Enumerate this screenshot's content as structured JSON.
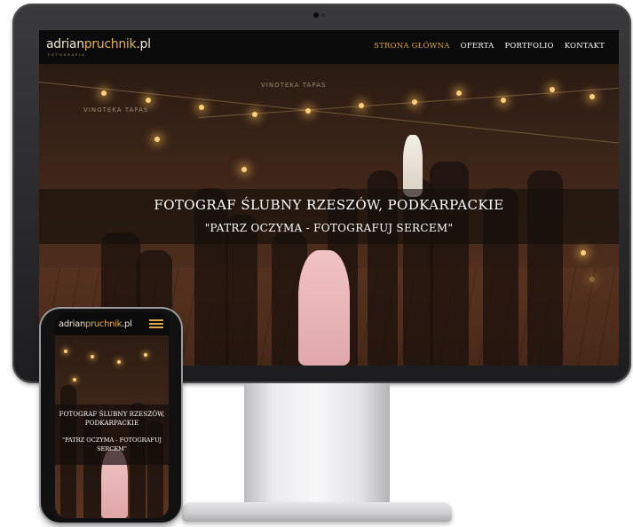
{
  "brand": {
    "logo_main": "adrian",
    "logo_accent": "pruchnik",
    "logo_suffix": ".pl",
    "logo_tagline": "FOTOGRAFIA",
    "accent_color": "#d9a64a"
  },
  "nav": {
    "items": [
      {
        "label": "STRONA GŁÓWNA",
        "active": true
      },
      {
        "label": "OFERTA",
        "active": false
      },
      {
        "label": "PORTFOLIO",
        "active": false
      },
      {
        "label": "KONTAKT",
        "active": false
      }
    ]
  },
  "hero": {
    "title": "FOTOGRAF ŚLUBNY RZESZÓW, PODKARPACKIE",
    "subtitle": "\"PATRZ OCZYMA - FOTOGRAFUJ SERCEM\""
  },
  "scene": {
    "sign_text": "VINOTEKA TAPAS"
  },
  "mobile": {
    "title_line1": "FOTOGRAF ŚLUBNY RZESZÓW,",
    "title_line2": "PODKARPACKIE",
    "subtitle_line1": "\"PATRZ OCZYMA - FOTOGRAFUJ",
    "subtitle_line2": "SERCEM\"",
    "menu_icon": "hamburger-menu-icon"
  }
}
